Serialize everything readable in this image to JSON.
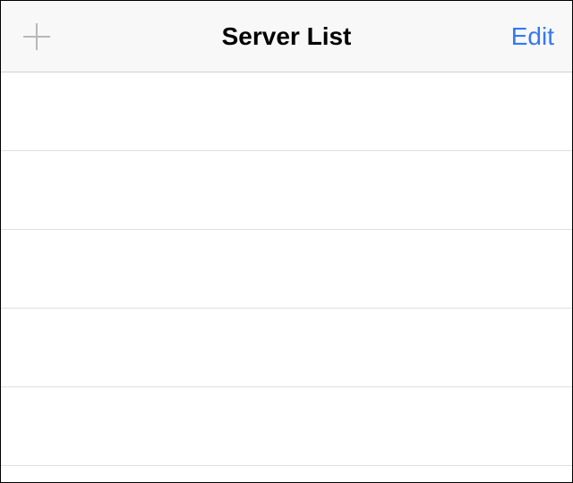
{
  "navbar": {
    "title": "Server List",
    "edit_label": "Edit"
  },
  "colors": {
    "tint": "#3478f6",
    "separator": "#d1d1d1",
    "nav_bg": "#f8f8f8",
    "icon_gray": "#b8b8b8"
  },
  "list": {
    "rows": [
      {},
      {},
      {},
      {},
      {}
    ]
  }
}
